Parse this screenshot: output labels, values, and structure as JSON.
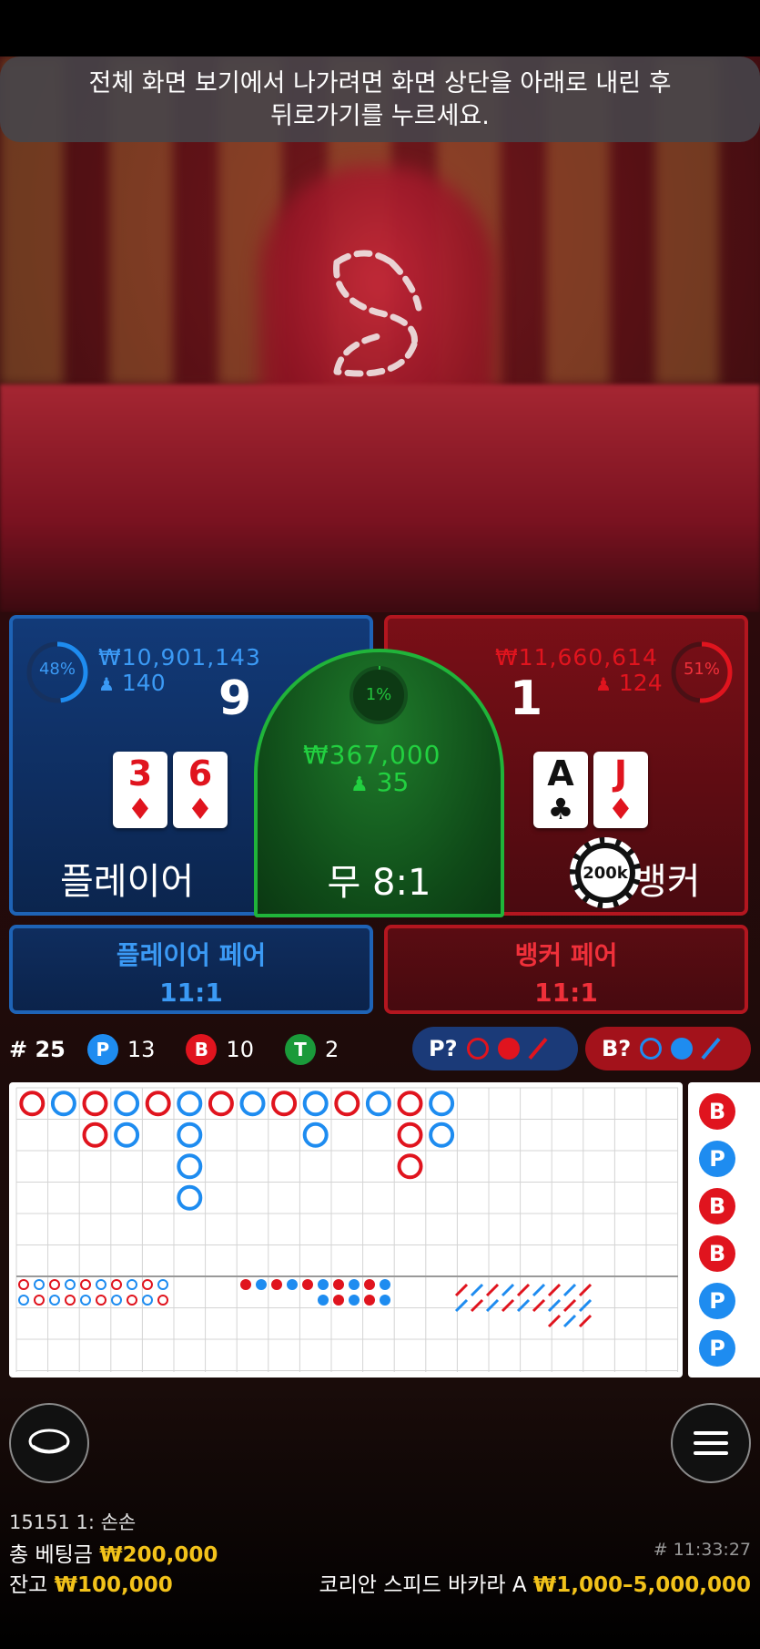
{
  "toast": {
    "line1": "전체 화면 보기에서 나가려면 화면 상단을 아래로 내린 후",
    "line2": "뒤로가기를 누르세요."
  },
  "player": {
    "percent": "48%",
    "percent_value": 48,
    "amount": "₩10,901,143",
    "bettors": "140",
    "score": "9",
    "cards": [
      {
        "rank": "3",
        "suit": "♦"
      },
      {
        "rank": "6",
        "suit": "♦"
      }
    ],
    "label": "플레이어"
  },
  "banker": {
    "percent": "51%",
    "percent_value": 51,
    "amount": "₩11,660,614",
    "bettors": "124",
    "score": "1",
    "cards": [
      {
        "rank": "A",
        "suit": "♣"
      },
      {
        "rank": "J",
        "suit": "♦"
      }
    ],
    "label": "뱅커",
    "chip": "200k"
  },
  "tie": {
    "percent": "1%",
    "percent_value": 1,
    "amount": "₩367,000",
    "bettors": "35",
    "label": "무 8:1"
  },
  "player_pair": {
    "title": "플레이어 페어",
    "odds": "11:1"
  },
  "banker_pair": {
    "title": "뱅커 페어",
    "odds": "11:1"
  },
  "stats": {
    "round": "# 25",
    "p_badge": "P",
    "p_count": "13",
    "b_badge": "B",
    "b_count": "10",
    "t_badge": "T",
    "t_count": "2"
  },
  "predict": {
    "player_label": "P?",
    "banker_label": "B?"
  },
  "bead_column": [
    "B",
    "P",
    "B",
    "B",
    "P",
    "P"
  ],
  "footer": {
    "user": "15151 1: 손손",
    "total_bet_label": "총 베팅금",
    "total_bet": "₩200,000",
    "balance_label": "잔고",
    "balance": "₩100,000",
    "round_time": "# 11:33:27",
    "table_name": "코리안 스피드 바카라 A",
    "limits": "₩1,000–5,000,000"
  },
  "colors": {
    "player": "#1e8cf0",
    "banker": "#e0141e",
    "tie": "#22c23c",
    "gold": "#f2c21a"
  }
}
